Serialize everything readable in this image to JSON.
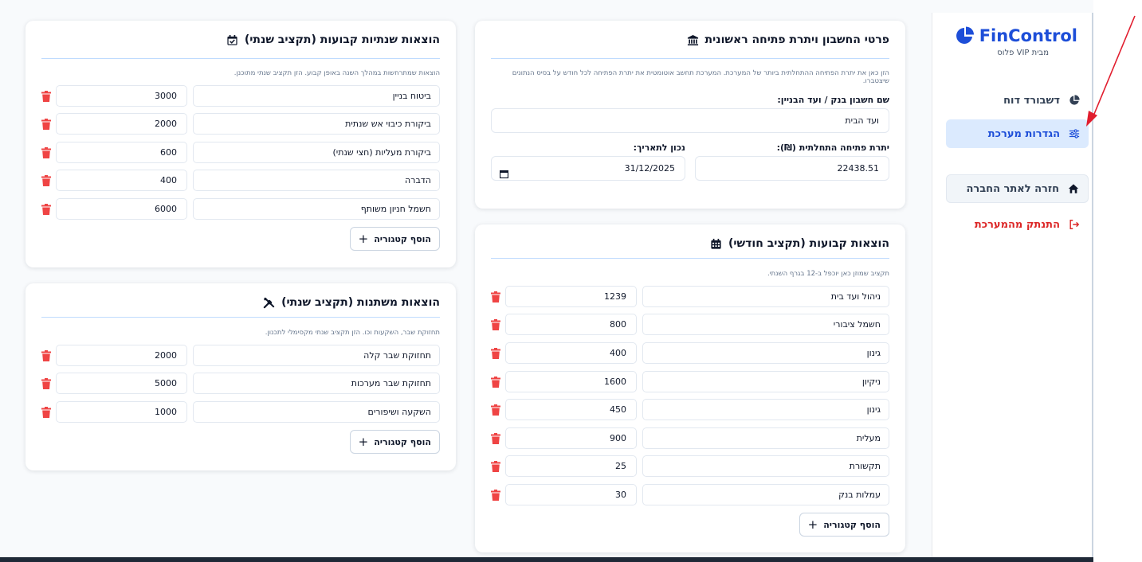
{
  "sidebar": {
    "brand": "FinControl",
    "brand_sub": "מבית VIP פלוס",
    "items": [
      {
        "label": "דשבורד דוח",
        "icon": "pie-chart-icon"
      },
      {
        "label": "הגדרות מערכת",
        "icon": "sliders-icon"
      },
      {
        "label": "חזרה לאתר החברה",
        "icon": "home-icon"
      },
      {
        "label": "התנתק מהמערכת",
        "icon": "logout-icon"
      }
    ]
  },
  "opening": {
    "title": "פרטי החשבון ויתרת פתיחה ראשונית",
    "icon": "bank-icon",
    "desc": "הזן כאן את יתרת הפתיחה ההתחלתית ביותר של המערכת. המערכת תחשב אוטומטית את יתרת הפתיחה לכל חודש על בסיס הנתונים שיצטברו.",
    "account_label": "שם חשבון בנק / ועד הבניין:",
    "account_value": "ועד הבית",
    "balance_label": "יתרת פתיחה התחלתית (₪):",
    "balance_value": "22438.51",
    "date_label": "נכון לתאריך:",
    "date_value": "31/12/2025"
  },
  "fixed_monthly": {
    "title": "הוצאות קבועות (תקציב חודשי)",
    "icon": "calendar-icon",
    "desc": "תקציב שמוזן כאן יוכפל ב-12 בגרף השנתי.",
    "rows": [
      {
        "name": "ניהול ועד בית",
        "amount": "1239"
      },
      {
        "name": "חשמל ציבורי",
        "amount": "800"
      },
      {
        "name": "גינון",
        "amount": "400"
      },
      {
        "name": "ניקיון",
        "amount": "1600"
      },
      {
        "name": "גינון",
        "amount": "450"
      },
      {
        "name": "מעלית",
        "amount": "900"
      },
      {
        "name": "תקשורת",
        "amount": "25"
      },
      {
        "name": "עמלות בנק",
        "amount": "30"
      }
    ],
    "add_label": "הוסף קטגוריה"
  },
  "annual_fixed": {
    "title": "הוצאות שנתיות קבועות (תקציב שנתי)",
    "icon": "calendar-check-icon",
    "desc": "הוצאות שמתרחשות במהלך השנה באופן קבוע. הזן תקציב שנתי מתוכנן.",
    "rows": [
      {
        "name": "ביטוח בניין",
        "amount": "3000"
      },
      {
        "name": "ביקורת כיבוי אש שנתית",
        "amount": "2000"
      },
      {
        "name": "ביקורת מעליות (חצי שנתי)",
        "amount": "600"
      },
      {
        "name": "הדברה",
        "amount": "400"
      },
      {
        "name": "חשמל חניון משותף",
        "amount": "6000"
      }
    ],
    "add_label": "הוסף קטגוריה"
  },
  "variable": {
    "title": "הוצאות משתנות (תקציב שנתי)",
    "icon": "tools-icon",
    "desc": "תחזוקת שבר, השקעות וכו. הזן תקציב שנתי מקסימלי לתכנון.",
    "rows": [
      {
        "name": "תחזוקת שבר קלה",
        "amount": "2000"
      },
      {
        "name": "תחזוקת שבר מערכות",
        "amount": "5000"
      },
      {
        "name": "השקעה ושיפורים",
        "amount": "1000"
      }
    ],
    "add_label": "הוסף קטגוריה"
  },
  "colors": {
    "brand": "#1d4ed8",
    "active_nav": "#dbeafe",
    "danger": "#dc2626",
    "annotation_arrow": "#e11d2e"
  }
}
